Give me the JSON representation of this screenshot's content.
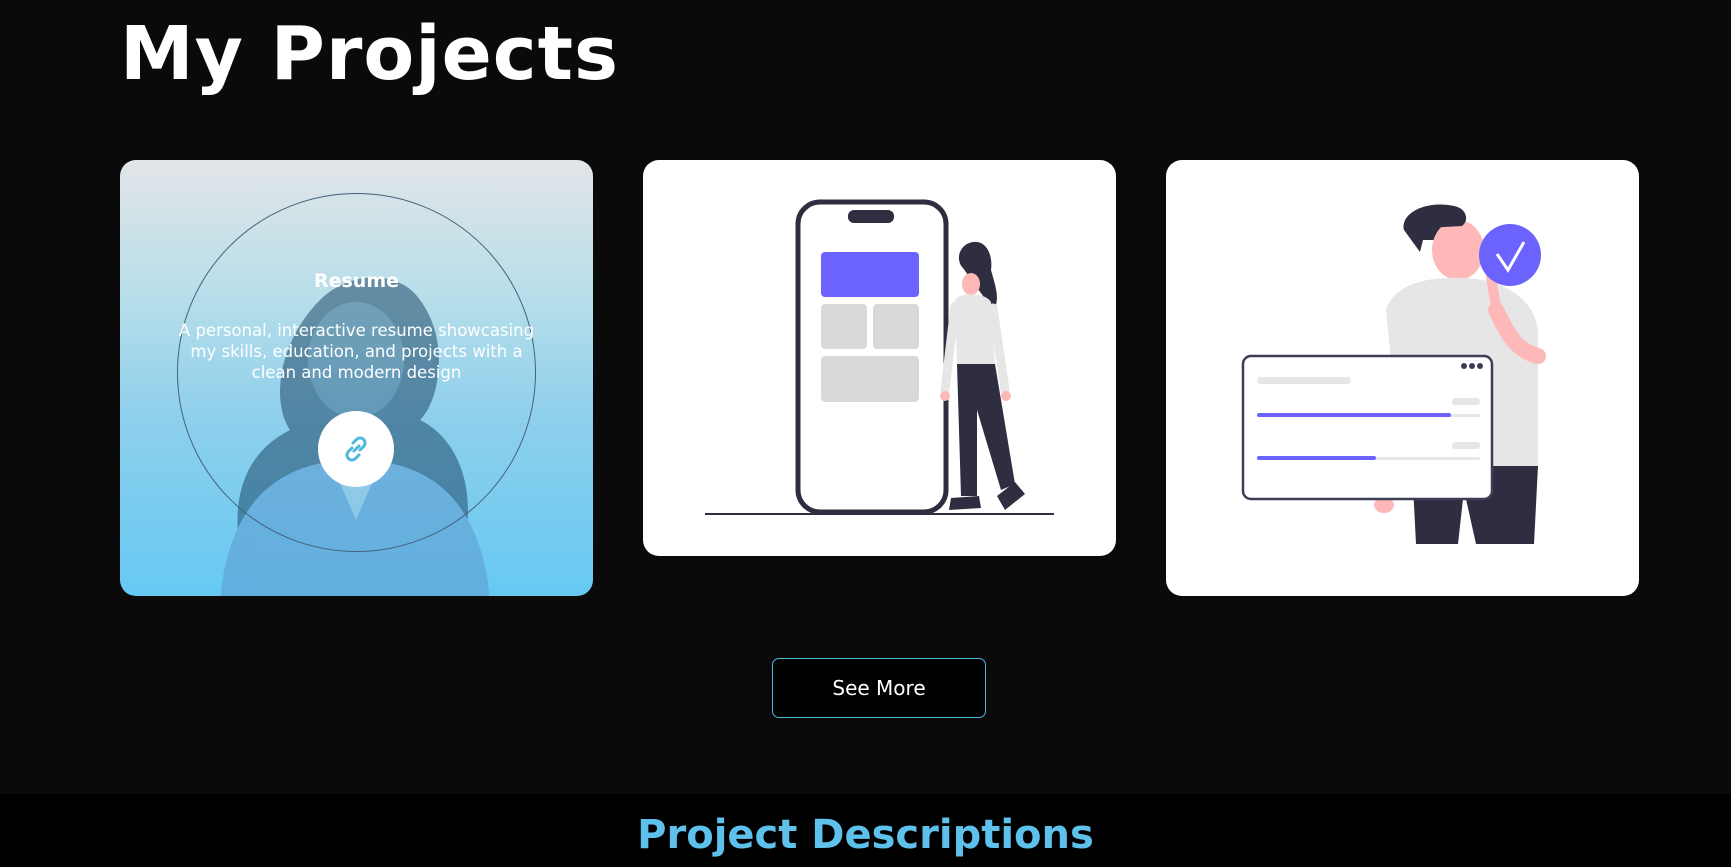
{
  "header": {
    "title": "My Projects"
  },
  "projects": [
    {
      "title": "Resume",
      "description": "A personal, interactive resume showcasing my skills, education, and projects with a clean and modern design",
      "link_icon": "link-icon",
      "illustration": "woman-avatar-illustration"
    },
    {
      "illustration": "woman-with-phone-illustration"
    },
    {
      "illustration": "man-with-checkmark-dashboard-illustration"
    }
  ],
  "actions": {
    "see_more_label": "See More"
  },
  "descriptions_section": {
    "heading": "Project Descriptions"
  },
  "colors": {
    "background": "#0a0a0a",
    "accent": "#5ec1ec",
    "illustration_purple": "#6c63ff",
    "illustration_dark": "#2f2e41"
  }
}
